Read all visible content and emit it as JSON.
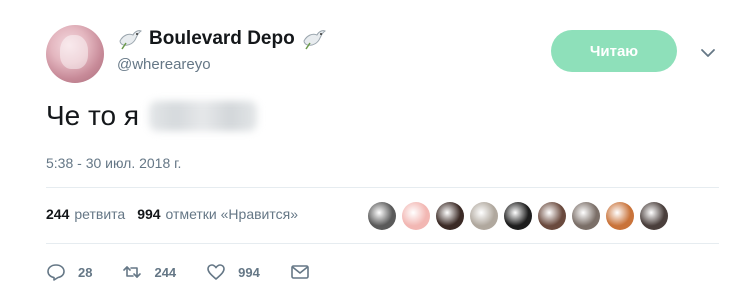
{
  "user": {
    "display_name": "Boulevard Depo",
    "handle": "@whereareyo"
  },
  "follow_button": {
    "label": "Читаю"
  },
  "tweet": {
    "text": "Че то я",
    "timestamp": "5:38 - 30 июл. 2018 г."
  },
  "stats": {
    "retweets_count": "244",
    "retweets_label": "ретвита",
    "likes_count": "994",
    "likes_label": "отметки «Нравится»"
  },
  "likers": [
    {
      "color": "#5a5a5a"
    },
    {
      "color": "#f2b7b3"
    },
    {
      "color": "#3b2a25"
    },
    {
      "color": "#b0a89e"
    },
    {
      "color": "#1e1e1e"
    },
    {
      "color": "#6a4a3e"
    },
    {
      "color": "#7b6f68"
    },
    {
      "color": "#c9733a"
    },
    {
      "color": "#4a3f3c"
    }
  ],
  "actions": {
    "replies": "28",
    "retweets": "244",
    "likes": "994"
  },
  "icons": {
    "reply": "reply-icon",
    "retweet": "retweet-icon",
    "like": "heart-icon",
    "dm": "envelope-icon",
    "caret": "chevron-down-icon",
    "dove": "dove-icon"
  }
}
